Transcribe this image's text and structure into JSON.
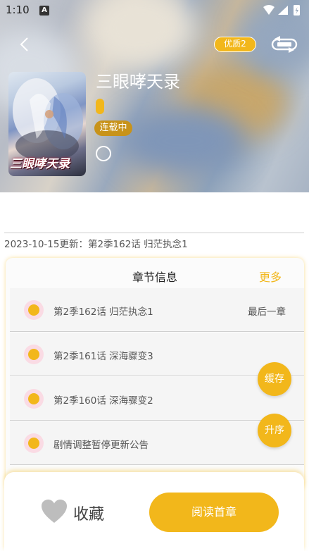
{
  "status_bar": {
    "time": "1:10",
    "app_icon_letter": "A"
  },
  "header": {
    "quality_badge": "优质2",
    "icons": [
      "back-icon",
      "switch-source-icon"
    ]
  },
  "book": {
    "title": "三眼哮天录",
    "status_tag": "连载中",
    "cover_text": "三眼哮天录"
  },
  "update_info": "2023-10-15更新：第2季162话 归茫执念1",
  "chapters": {
    "title": "章节信息",
    "more_label": "更多",
    "items": [
      {
        "name": "第2季162话 归茫执念1",
        "meta": "最后一章"
      },
      {
        "name": "第2季161话 深海骤变3",
        "meta": ""
      },
      {
        "name": "第2季160话 深海骤变2",
        "meta": ""
      },
      {
        "name": "剧情调整暂停更新公告",
        "meta": ""
      }
    ]
  },
  "actions": {
    "cache_label": "缓存",
    "sort_label": "升序"
  },
  "bottom": {
    "collect_label": "收藏",
    "read_label": "阅读首章"
  },
  "colors": {
    "accent": "#f2b71b",
    "tag": "#c8931a",
    "dot_ring": "#fadbe4"
  }
}
